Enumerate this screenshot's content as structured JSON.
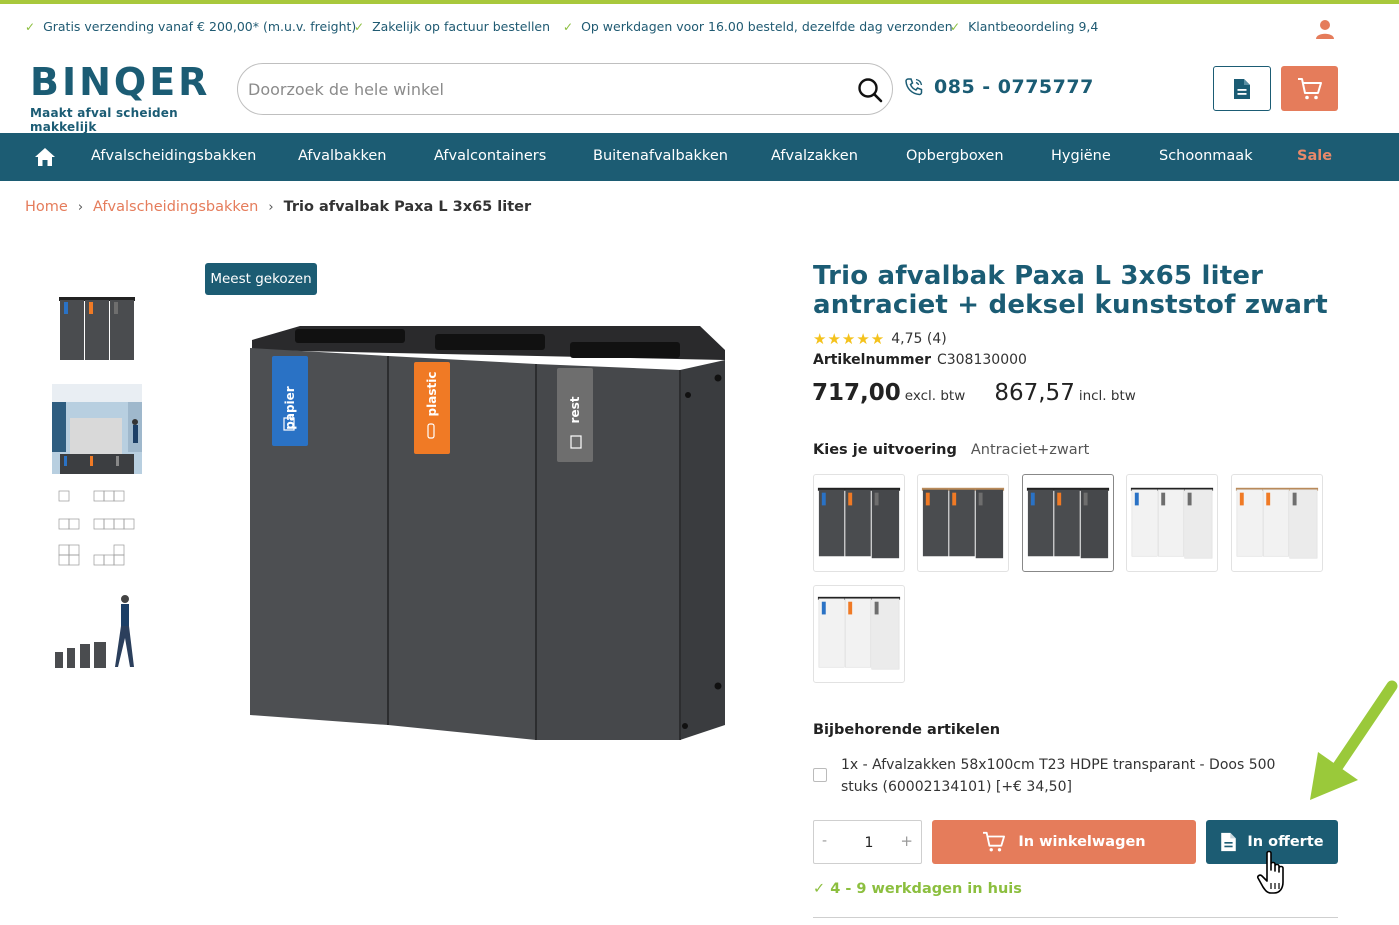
{
  "usp": [
    "Gratis verzending vanaf € 200,00* (m.u.v. freight)",
    "Zakelijk op factuur bestellen",
    "Op werkdagen voor 16.00 besteld, dezelfde dag verzonden",
    "Klantbeoordeling 9,4"
  ],
  "logo": {
    "word": "BINQER",
    "tagline": "Maakt afval scheiden makkelijk"
  },
  "search": {
    "placeholder": "Doorzoek de hele winkel"
  },
  "phone": "085 - 0775777",
  "nav": [
    "Afvalscheidingsbakken",
    "Afvalbakken",
    "Afvalcontainers",
    "Buitenafvalbakken",
    "Afvalzakken",
    "Opbergboxen",
    "Hygiëne",
    "Schoonmaak",
    "Sale"
  ],
  "breadcrumb": {
    "home": "Home",
    "category": "Afvalscheidingsbakken",
    "current": "Trio afvalbak Paxa L 3x65 liter"
  },
  "badge": "Meest gekozen",
  "product": {
    "title": "Trio afvalbak Paxa L 3x65 liter antraciet + deksel kunststof zwart",
    "stars": "★★★★★",
    "rating": "4,75 (4)",
    "sku_label": "Artikelnummer",
    "sku": "C308130000",
    "price_excl": "717,00",
    "price_excl_label": "excl. btw",
    "price_incl": "867,57",
    "price_incl_label": "incl. btw",
    "variant_label": "Kies je uitvoering",
    "variant_value": "Antraciet+zwart"
  },
  "bin_labels": [
    "papier",
    "plastic",
    "rest"
  ],
  "related": {
    "title": "Bijbehorende artikelen",
    "item": "1x - Afvalzakken 58x100cm T23 HDPE transparant - Doos 500 stuks (60002134101) [+€ 34,50]"
  },
  "cart": {
    "qty_minus": "-",
    "qty": "1",
    "qty_plus": "+",
    "add_label": "In winkelwagen",
    "offerte_label": "In offerte",
    "delivery": "✓ 4 - 9 werkdagen in huis"
  },
  "colors": {
    "brand": "#1c5c73",
    "accent": "#e57c5b",
    "green": "#8cbf3f",
    "star": "#f4c21c",
    "bin_body": "#4a4c4f",
    "bin_white": "#f2f2f2",
    "label_blue": "#2a72c5",
    "label_orange": "#f07a25",
    "label_grey": "#6e6e6e"
  },
  "icons": [
    "check-icon",
    "user-icon",
    "search-icon",
    "phone-icon",
    "document-icon",
    "cart-icon",
    "home-icon",
    "arrow-icon",
    "hand-cursor-icon"
  ]
}
